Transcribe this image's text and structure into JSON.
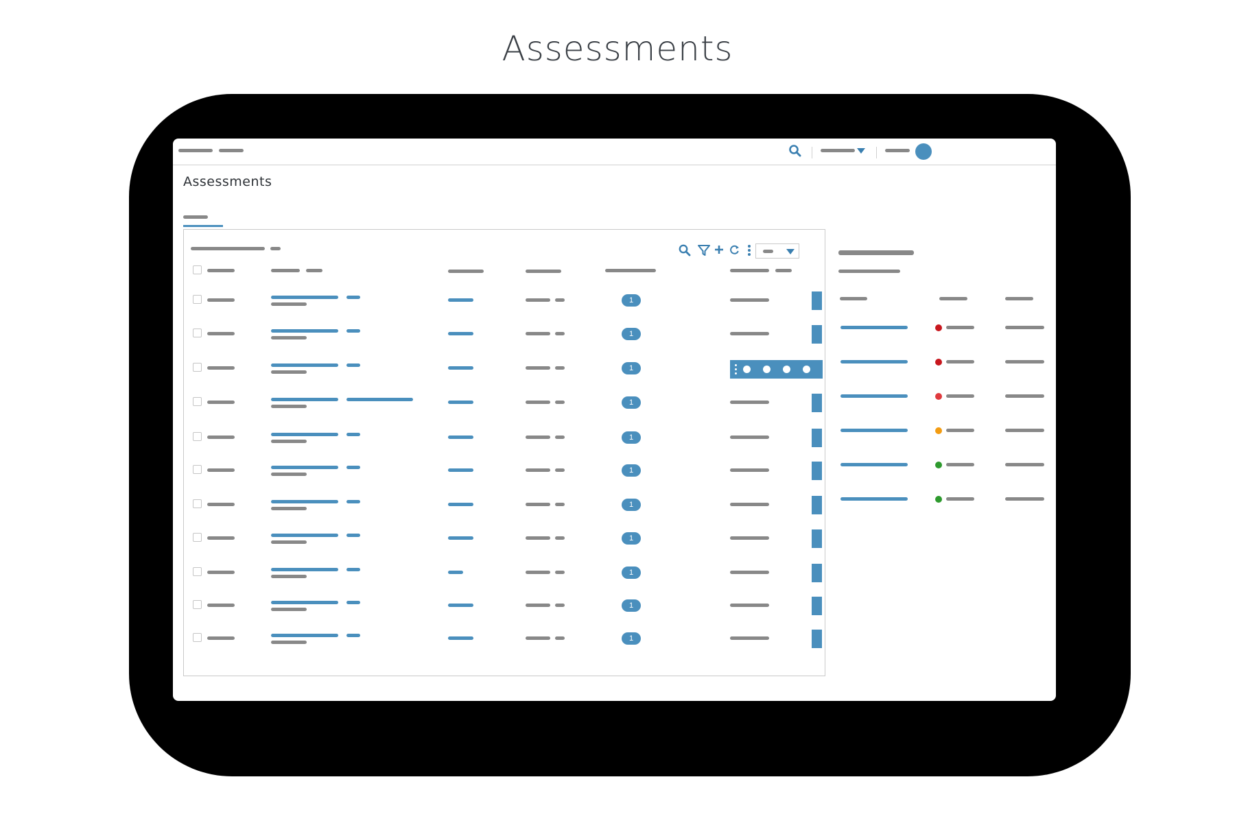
{
  "page": {
    "headline": "Assessments"
  },
  "app": {
    "title": "Assessments"
  },
  "colors": {
    "accent": "#4a8fbd",
    "placeholder": "#888888",
    "status_critical": "#c8171e",
    "status_high": "#e03a3e",
    "status_medium": "#f39c12",
    "status_low": "#2e9a2e"
  },
  "icons": {
    "search": "search-icon",
    "filter": "filter-icon",
    "add": "plus-icon",
    "refresh": "refresh-icon",
    "more": "kebab-menu-icon",
    "dropdown": "caret-down-icon"
  },
  "table": {
    "badge_label": "1",
    "rows": [
      {
        "badge": "1"
      },
      {
        "badge": "1"
      },
      {
        "badge": "1"
      },
      {
        "badge": "1"
      },
      {
        "badge": "1"
      },
      {
        "badge": "1"
      },
      {
        "badge": "1"
      },
      {
        "badge": "1"
      },
      {
        "badge": "1"
      },
      {
        "badge": "1"
      },
      {
        "badge": "1"
      }
    ]
  },
  "side_panel": {
    "rows": [
      {
        "status": "critical"
      },
      {
        "status": "critical"
      },
      {
        "status": "high"
      },
      {
        "status": "medium"
      },
      {
        "status": "low"
      },
      {
        "status": "low"
      }
    ]
  }
}
